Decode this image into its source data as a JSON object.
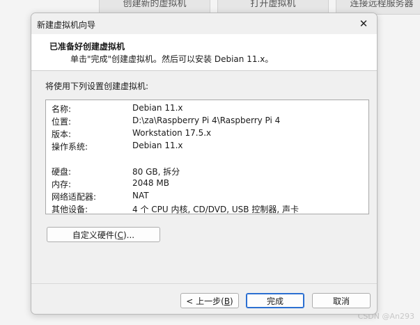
{
  "background": {
    "tiles": [
      "创建新的虚拟机",
      "打开虚拟机",
      "连接远程服务器"
    ],
    "watermark": "CSDN @An293"
  },
  "dialog": {
    "title": "新建虚拟机向导",
    "header_title": "已准备好创建虚拟机",
    "header_subtitle": "单击\"完成\"创建虚拟机。然后可以安装 Debian 11.x。",
    "intro": "将使用下列设置创建虚拟机:",
    "summary": [
      {
        "key": "名称:",
        "value": "Debian 11.x"
      },
      {
        "key": "位置:",
        "value": "D:\\za\\Raspberry Pi 4\\Raspberry Pi 4"
      },
      {
        "key": "版本:",
        "value": "Workstation 17.5.x"
      },
      {
        "key": "操作系统:",
        "value": "Debian 11.x"
      },
      {
        "key": "硬盘:",
        "value": "80 GB, 拆分"
      },
      {
        "key": "内存:",
        "value": "2048 MB"
      },
      {
        "key": "网络适配器:",
        "value": "NAT"
      },
      {
        "key": "其他设备:",
        "value": "4 个 CPU 内核, CD/DVD, USB 控制器, 声卡"
      }
    ],
    "customize_button": {
      "prefix": "自定义硬件(",
      "accel": "C",
      "suffix": ")..."
    },
    "back_button": {
      "prefix": "< 上一步(",
      "accel": "B",
      "suffix": ")"
    },
    "finish_button": "完成",
    "cancel_button": "取消"
  }
}
